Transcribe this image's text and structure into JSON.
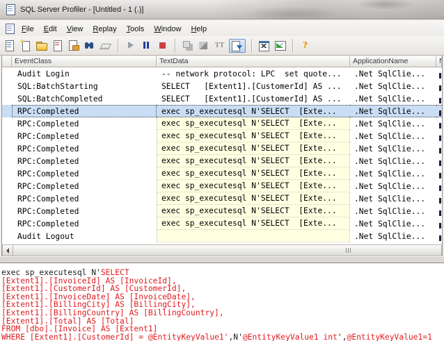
{
  "window": {
    "title": "SQL Server Profiler - [Untitled - 1 (.)]"
  },
  "menu": {
    "items": [
      "File",
      "Edit",
      "View",
      "Replay",
      "Tools",
      "Window",
      "Help"
    ]
  },
  "toolbar": {
    "icons": [
      "open-trace-file-icon",
      "new-trace-icon",
      "open-folder-icon",
      "save-trace-icon",
      "properties-icon",
      "find-icon",
      "clear-trace-window-icon",
      "|",
      "start-replay-icon",
      "pause-trace-icon",
      "stop-trace-icon",
      "|",
      "execute-step-icon",
      "run-to-cursor-icon",
      "toggle-font-icon",
      "auto-scroll-icon",
      "|",
      "database-engine-tuning-icon",
      "performance-counters-icon",
      "|",
      "help-icon"
    ]
  },
  "grid": {
    "columns": [
      "",
      "EventClass",
      "TextData",
      "ApplicationName",
      "N"
    ],
    "rows": [
      {
        "event": "Audit Login",
        "text": "-- network protocol: LPC  set quote...",
        "app": ".Net SqlClie...",
        "yellow": false,
        "selected": false
      },
      {
        "event": "SQL:BatchStarting",
        "text": "SELECT   [Extent1].[CustomerId] AS ...",
        "app": ".Net SqlClie...",
        "yellow": false,
        "selected": false
      },
      {
        "event": "SQL:BatchCompleted",
        "text": "SELECT   [Extent1].[CustomerId] AS ...",
        "app": ".Net SqlClie...",
        "yellow": false,
        "selected": false
      },
      {
        "event": "RPC:Completed",
        "text": "exec sp_executesql N'SELECT  [Exte...",
        "app": ".Net SqlClie...",
        "yellow": false,
        "selected": true
      },
      {
        "event": "RPC:Completed",
        "text": "exec sp_executesql N'SELECT  [Exte...",
        "app": ".Net SqlClie...",
        "yellow": true,
        "selected": false
      },
      {
        "event": "RPC:Completed",
        "text": "exec sp_executesql N'SELECT  [Exte...",
        "app": ".Net SqlClie...",
        "yellow": true,
        "selected": false
      },
      {
        "event": "RPC:Completed",
        "text": "exec sp_executesql N'SELECT  [Exte...",
        "app": ".Net SqlClie...",
        "yellow": true,
        "selected": false
      },
      {
        "event": "RPC:Completed",
        "text": "exec sp_executesql N'SELECT  [Exte...",
        "app": ".Net SqlClie...",
        "yellow": true,
        "selected": false
      },
      {
        "event": "RPC:Completed",
        "text": "exec sp_executesql N'SELECT  [Exte...",
        "app": ".Net SqlClie...",
        "yellow": true,
        "selected": false
      },
      {
        "event": "RPC:Completed",
        "text": "exec sp_executesql N'SELECT  [Exte...",
        "app": ".Net SqlClie...",
        "yellow": true,
        "selected": false
      },
      {
        "event": "RPC:Completed",
        "text": "exec sp_executesql N'SELECT  [Exte...",
        "app": ".Net SqlClie...",
        "yellow": true,
        "selected": false
      },
      {
        "event": "RPC:Completed",
        "text": "exec sp_executesql N'SELECT  [Exte...",
        "app": ".Net SqlClie...",
        "yellow": true,
        "selected": false
      },
      {
        "event": "RPC:Completed",
        "text": "exec sp_executesql N'SELECT  [Exte...",
        "app": ".Net SqlClie...",
        "yellow": true,
        "selected": false
      },
      {
        "event": "Audit Logout",
        "text": "",
        "app": ".Net SqlClie...",
        "yellow": true,
        "selected": false
      }
    ]
  },
  "detail": {
    "lines": [
      [
        {
          "c": "k",
          "t": "exec sp_executesql N'"
        },
        {
          "c": "r",
          "t": "SELECT"
        }
      ],
      [
        {
          "c": "r",
          "t": "[Extent1].[InvoiceId] AS [InvoiceId],"
        }
      ],
      [
        {
          "c": "r",
          "t": "[Extent1].[CustomerId] AS [CustomerId],"
        }
      ],
      [
        {
          "c": "r",
          "t": "[Extent1].[InvoiceDate] AS [InvoiceDate],"
        }
      ],
      [
        {
          "c": "r",
          "t": "[Extent1].[BillingCity] AS [BillingCity],"
        }
      ],
      [
        {
          "c": "r",
          "t": "[Extent1].[BillingCountry] AS [BillingCountry],"
        }
      ],
      [
        {
          "c": "r",
          "t": "[Extent1].[Total] AS [Total]"
        }
      ],
      [
        {
          "c": "r",
          "t": "FROM [dbo].[Invoice] AS [Extent1]"
        }
      ],
      [
        {
          "c": "r",
          "t": "WHERE [Extent1].[CustomerId] = @EntityKeyValue1'"
        },
        {
          "c": "k",
          "t": ",N'"
        },
        {
          "c": "r",
          "t": "@EntityKeyValue1 int"
        },
        {
          "c": "k",
          "t": "',"
        },
        {
          "c": "r",
          "t": "@EntityKeyValue1=1"
        }
      ]
    ]
  }
}
